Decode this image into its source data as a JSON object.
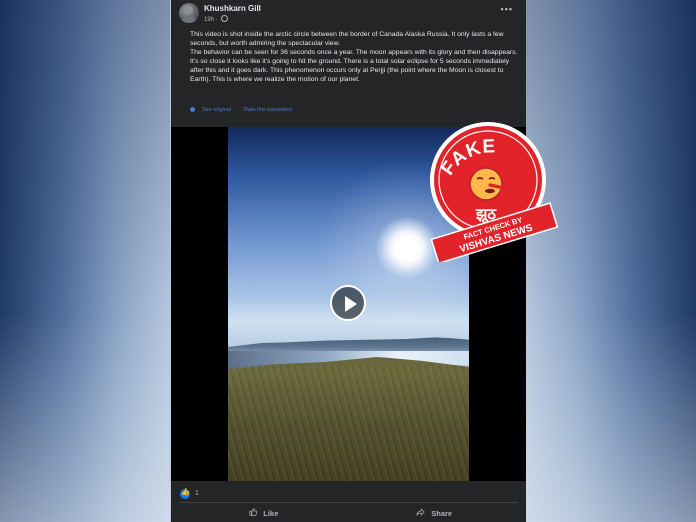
{
  "post": {
    "author": "Khushkarn Gill",
    "time": "19h",
    "privacy_icon": "globe-icon",
    "more_label": "•••",
    "paragraphs": [
      "This video is shot inside the arctic circle between the border of Canada Alaska Russia. It only lasts a few seconds, but worth admiring the spectacular view.",
      "The behavior can be seen for 36 seconds once a year. The moon appears with its glory and then disappears. It's so close it looks like it's going to hit the ground. There is a total solar eclipse for 5 seconds immediately after this and it goes dark. This phenomenon occurs only at Perjji (the point where the Moon is closest to Earth). This is where we realize the motion of our planet."
    ],
    "see_original": "See original",
    "rate_translation": "Rate this translation",
    "reaction_count": "1",
    "like_label": "Like",
    "share_label": "Share"
  },
  "badge": {
    "top_text": "FAKE",
    "hindi_text": "झूठ",
    "ribbon_line1": "FACT CHECK BY",
    "ribbon_line2": "VISHVAS NEWS"
  },
  "colors": {
    "post_bg": "#242526",
    "badge_red": "#e2232a",
    "link_blue": "#4b7bd0"
  }
}
